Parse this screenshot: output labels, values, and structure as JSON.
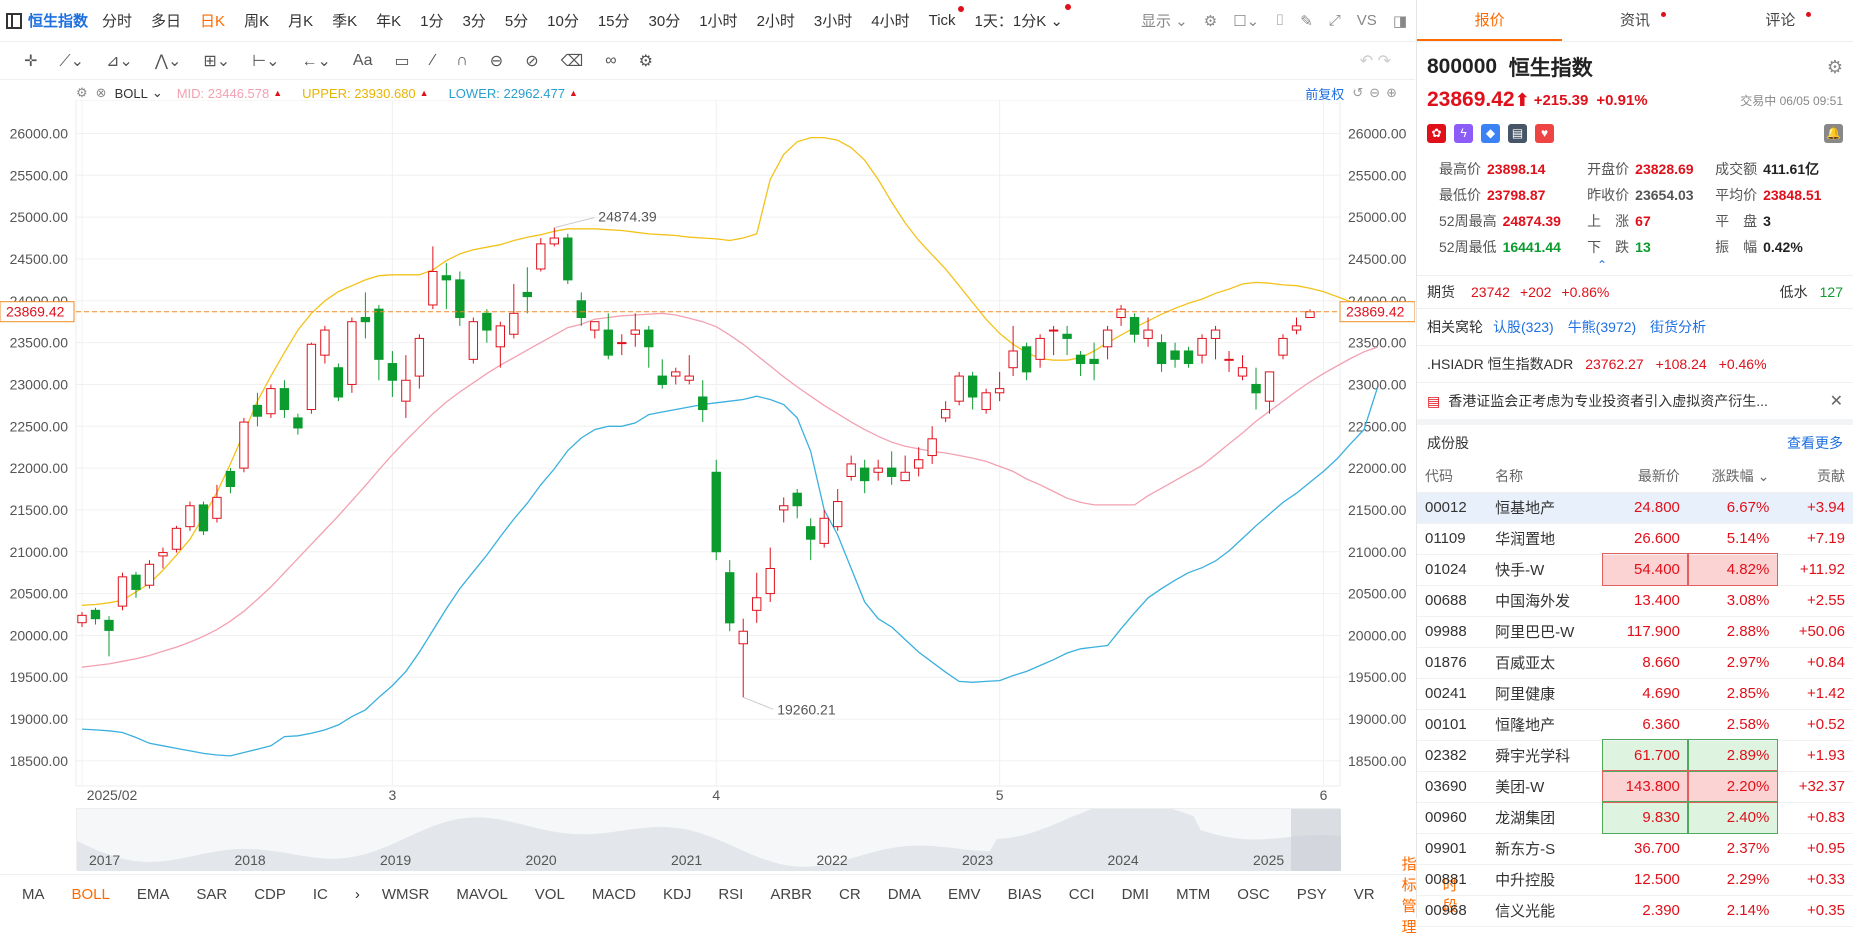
{
  "topbar": {
    "name": "恒生指数",
    "periods": [
      "分时",
      "多日",
      "日K",
      "周K",
      "月K",
      "季K",
      "年K",
      "1分",
      "3分",
      "5分",
      "10分",
      "15分",
      "30分",
      "1小时",
      "2小时",
      "3小时",
      "4小时",
      "Tick"
    ],
    "active": "日K",
    "dots": [
      "Tick"
    ],
    "range": "1天：1分K",
    "display": "显示"
  },
  "indicator": {
    "name": "BOLL",
    "mid_label": "MID:",
    "mid": "23446.578",
    "upper_label": "UPPER:",
    "upper": "23930.680",
    "lower_label": "LOWER:",
    "lower": "22962.477",
    "adjust": "前复权"
  },
  "colors": {
    "up": "#e0101b",
    "down": "#0b9b2e",
    "mid": "#f3a0b1",
    "upper": "#f3c21a",
    "lower": "#3ab0de",
    "accent": "#ff6a00",
    "link": "#1e6fe0"
  },
  "chart_data": {
    "type": "candlestick",
    "ylim": [
      18200,
      26400
    ],
    "yticks": [
      18500,
      19000,
      19500,
      20000,
      20500,
      21000,
      21500,
      22000,
      22500,
      23000,
      23500,
      24000,
      24500,
      25000,
      25500,
      26000
    ],
    "xlabels": [
      "2025/02",
      "3",
      "4",
      "5",
      "6"
    ],
    "current_price": "23869.42",
    "high_annotation": "24874.39",
    "low_annotation": "19260.21",
    "candles": [
      [
        20152,
        20240,
        20100,
        20280
      ],
      [
        20300,
        20200,
        20130,
        20330
      ],
      [
        20180,
        20060,
        19750,
        20230
      ],
      [
        20350,
        20700,
        20300,
        20750
      ],
      [
        20720,
        20550,
        20450,
        20760
      ],
      [
        20600,
        20850,
        20560,
        20900
      ],
      [
        20950,
        20990,
        20800,
        21050
      ],
      [
        21030,
        21280,
        20990,
        21310
      ],
      [
        21300,
        21550,
        21250,
        21600
      ],
      [
        21560,
        21250,
        21200,
        21600
      ],
      [
        21400,
        21650,
        21350,
        21800
      ],
      [
        21960,
        21780,
        21700,
        22000
      ],
      [
        22000,
        22550,
        21950,
        22600
      ],
      [
        22750,
        22620,
        22500,
        22900
      ],
      [
        22650,
        22950,
        22600,
        23000
      ],
      [
        22950,
        22700,
        22600,
        23050
      ],
      [
        22600,
        22480,
        22400,
        22650
      ],
      [
        22700,
        23480,
        22650,
        23500
      ],
      [
        23350,
        23650,
        23250,
        23700
      ],
      [
        23200,
        22850,
        22800,
        23250
      ],
      [
        23000,
        23750,
        22900,
        23800
      ],
      [
        23800,
        23750,
        23550,
        24100
      ],
      [
        23900,
        23300,
        23050,
        23950
      ],
      [
        23250,
        23050,
        22850,
        23400
      ],
      [
        22800,
        23050,
        22600,
        23350
      ],
      [
        23100,
        23550,
        22950,
        23600
      ],
      [
        23950,
        24350,
        23900,
        24650
      ],
      [
        24300,
        24250,
        23900,
        24450
      ],
      [
        24250,
        23800,
        23700,
        24350
      ],
      [
        23300,
        23750,
        23250,
        23800
      ],
      [
        23850,
        23650,
        23500,
        23900
      ],
      [
        23450,
        23700,
        23200,
        23750
      ],
      [
        23600,
        23850,
        23550,
        24200
      ],
      [
        24100,
        24050,
        23850,
        24400
      ],
      [
        24380,
        24680,
        24350,
        24750
      ],
      [
        24680,
        24750,
        24650,
        24874
      ],
      [
        24750,
        24250,
        24200,
        24800
      ],
      [
        24000,
        23800,
        23700,
        24100
      ],
      [
        23650,
        23750,
        23550,
        23750
      ],
      [
        23650,
        23350,
        23300,
        23850
      ],
      [
        23500,
        23500,
        23350,
        23600
      ],
      [
        23600,
        23650,
        23450,
        23850
      ],
      [
        23650,
        23450,
        23200,
        23700
      ],
      [
        23100,
        23000,
        22950,
        23300
      ],
      [
        23100,
        23150,
        23000,
        23200
      ],
      [
        23050,
        23100,
        23000,
        23350
      ],
      [
        22850,
        22700,
        22550,
        23050
      ],
      [
        21950,
        21000,
        20900,
        22100
      ],
      [
        20750,
        20150,
        20050,
        20900
      ],
      [
        19900,
        20050,
        19260,
        20200
      ],
      [
        20300,
        20450,
        20150,
        20750
      ],
      [
        20500,
        20800,
        20400,
        21050
      ],
      [
        21500,
        21550,
        21350,
        21650
      ],
      [
        21700,
        21550,
        21400,
        21750
      ],
      [
        21300,
        21150,
        20900,
        21400
      ],
      [
        21100,
        21400,
        21050,
        21500
      ],
      [
        21300,
        21600,
        21250,
        21750
      ],
      [
        21900,
        22050,
        21850,
        22150
      ],
      [
        22000,
        21850,
        21700,
        22100
      ],
      [
        21950,
        22000,
        21850,
        22100
      ],
      [
        22000,
        21900,
        21800,
        22200
      ],
      [
        21850,
        21950,
        21850,
        22150
      ],
      [
        22000,
        22100,
        21900,
        22250
      ],
      [
        22150,
        22350,
        22050,
        22500
      ],
      [
        22600,
        22700,
        22550,
        22800
      ],
      [
        22800,
        23100,
        22750,
        23150
      ],
      [
        23100,
        22850,
        22700,
        23150
      ],
      [
        22700,
        22900,
        22650,
        22950
      ],
      [
        22900,
        22950,
        22800,
        23150
      ],
      [
        23200,
        23400,
        23100,
        23700
      ],
      [
        23450,
        23150,
        23050,
        23500
      ],
      [
        23300,
        23550,
        23200,
        23600
      ],
      [
        23650,
        23650,
        23350,
        23700
      ],
      [
        23600,
        23550,
        23350,
        23700
      ],
      [
        23350,
        23250,
        23100,
        23400
      ],
      [
        23300,
        23250,
        23050,
        23500
      ],
      [
        23450,
        23650,
        23300,
        23700
      ],
      [
        23800,
        23900,
        23700,
        23950
      ],
      [
        23800,
        23600,
        23500,
        23850
      ],
      [
        23550,
        23650,
        23450,
        23800
      ],
      [
        23500,
        23250,
        23150,
        23600
      ],
      [
        23400,
        23300,
        23200,
        23500
      ],
      [
        23400,
        23250,
        23200,
        23450
      ],
      [
        23350,
        23550,
        23250,
        23600
      ],
      [
        23550,
        23650,
        23300,
        23700
      ],
      [
        23300,
        23300,
        23150,
        23400
      ],
      [
        23100,
        23200,
        23050,
        23350
      ],
      [
        23000,
        22900,
        22700,
        23200
      ],
      [
        22800,
        23150,
        22650,
        23150
      ],
      [
        23350,
        23550,
        23300,
        23600
      ],
      [
        23650,
        23700,
        23600,
        23800
      ],
      [
        23800,
        23869,
        23798,
        23898
      ]
    ],
    "mid": [
      19620,
      19640,
      19660,
      19690,
      19720,
      19760,
      19810,
      19860,
      19920,
      19990,
      20070,
      20170,
      20290,
      20430,
      20580,
      20750,
      20920,
      21090,
      21260,
      21430,
      21610,
      21790,
      21980,
      22160,
      22330,
      22490,
      22650,
      22790,
      22910,
      23020,
      23130,
      23230,
      23320,
      23410,
      23500,
      23590,
      23680,
      23720,
      23780,
      23800,
      23820,
      23830,
      23840,
      23850,
      23830,
      23790,
      23750,
      23690,
      23590,
      23480,
      23350,
      23220,
      23090,
      22970,
      22860,
      22750,
      22650,
      22550,
      22460,
      22380,
      22310,
      22260,
      22230,
      22200,
      22180,
      22150,
      22120,
      22080,
      22020,
      21960,
      21870,
      21800,
      21720,
      21640,
      21590,
      21560,
      21560,
      21560,
      21560,
      21670,
      21760,
      21850,
      21940,
      22030,
      22160,
      22290,
      22420,
      22560,
      22680,
      22800,
      22920,
      23030,
      23130,
      23220,
      23310,
      23390,
      23446
    ],
    "upper": [
      20360,
      20370,
      20390,
      20420,
      20520,
      20620,
      20780,
      20960,
      21150,
      21420,
      21710,
      22050,
      22420,
      22800,
      23100,
      23380,
      23650,
      23850,
      24000,
      24110,
      24180,
      24250,
      24300,
      24310,
      24310,
      24310,
      24370,
      24480,
      24560,
      24610,
      24640,
      24670,
      24720,
      24760,
      24790,
      24830,
      24860,
      24860,
      24860,
      24850,
      24840,
      24820,
      24800,
      24790,
      24780,
      24760,
      24750,
      24740,
      24720,
      24750,
      24800,
      25450,
      25750,
      25900,
      25950,
      25950,
      25920,
      25830,
      25680,
      25450,
      25180,
      24930,
      24720,
      24550,
      24380,
      24180,
      23980,
      23780,
      23610,
      23480,
      23380,
      23310,
      23290,
      23290,
      23320,
      23400,
      23500,
      23590,
      23680,
      23760,
      23840,
      23910,
      23970,
      24020,
      24090,
      24140,
      24200,
      24220,
      24210,
      24190,
      24180,
      24150,
      24110,
      24050,
      23990,
      23940,
      23930
    ],
    "lower": [
      18880,
      18870,
      18860,
      18840,
      18780,
      18710,
      18680,
      18650,
      18620,
      18590,
      18570,
      18560,
      18600,
      18640,
      18680,
      18790,
      18800,
      18830,
      18870,
      18930,
      19030,
      19110,
      19260,
      19400,
      19570,
      19800,
      20060,
      20320,
      20560,
      20760,
      20960,
      21180,
      21390,
      21580,
      21800,
      21990,
      22210,
      22360,
      22460,
      22500,
      22500,
      22540,
      22640,
      22670,
      22700,
      22730,
      22760,
      22780,
      22800,
      22820,
      22860,
      22820,
      22760,
      22600,
      22200,
      21500,
      21200,
      20800,
      20400,
      20200,
      20100,
      19950,
      19800,
      19680,
      19560,
      19450,
      19440,
      19450,
      19460,
      19520,
      19570,
      19640,
      19710,
      19790,
      19840,
      19860,
      19880,
      20080,
      20270,
      20450,
      20560,
      20660,
      20750,
      20810,
      20890,
      21010,
      21160,
      21310,
      21450,
      21590,
      21700,
      21830,
      21960,
      22110,
      22290,
      22460,
      22962
    ]
  },
  "navigator": {
    "years": [
      "2017",
      "2018",
      "2019",
      "2020",
      "2021",
      "2022",
      "2023",
      "2024",
      "2025"
    ]
  },
  "bottom": {
    "tabs": [
      "MA",
      "BOLL",
      "EMA",
      "SAR",
      "CDP",
      "IC",
      "WMSR",
      "MAVOL",
      "VOL",
      "MACD",
      "KDJ",
      "RSI",
      "ARBR",
      "CR",
      "DMA",
      "EMV",
      "BIAS",
      "CCI",
      "DMI",
      "MTM",
      "OSC",
      "PSY",
      "VR"
    ],
    "active": "BOLL",
    "manage": "指标管理",
    "period": "时段"
  },
  "right": {
    "tabs": [
      "报价",
      "资讯",
      "评论"
    ],
    "code": "800000",
    "name": "恒生指数",
    "price": "23869.42",
    "arrow": "⬆",
    "chg": "+215.39",
    "pct": "+0.91%",
    "status": "交易中 06/05 09:51",
    "stats": [
      [
        [
          "最高价",
          "23898.14",
          "red"
        ],
        [
          "开盘价",
          "23828.69",
          "red"
        ],
        [
          "成交额",
          "411.61亿",
          "dark"
        ]
      ],
      [
        [
          "最低价",
          "23798.87",
          "red"
        ],
        [
          "昨收价",
          "23654.03",
          "gray"
        ],
        [
          "平均价",
          "23848.51",
          "red"
        ]
      ],
      [
        [
          "52周最高",
          "24874.39",
          "red"
        ],
        [
          "上　涨",
          "67",
          "red"
        ],
        [
          "平　盘",
          "3",
          "dark"
        ]
      ],
      [
        [
          "52周最低",
          "16441.44",
          "green"
        ],
        [
          "下　跌",
          "13",
          "green"
        ],
        [
          "振　幅",
          "0.42%",
          "dark"
        ]
      ]
    ],
    "futures": {
      "label": "期货",
      "price": "23742",
      "chg": "+202",
      "pct": "+0.86%",
      "discount": "低水",
      "value": "127"
    },
    "links": {
      "label": "相关窝轮",
      "a": "认股(323)",
      "b": "牛熊(3972)",
      "c": "街货分析"
    },
    "adr": {
      "label": ".HSIADR 恒生指数ADR",
      "price": "23762.27",
      "chg": "+108.24",
      "pct": "+0.46%"
    },
    "news": "香港证监会正考虑为专业投资者引入虚拟资产衍生...",
    "constituents": {
      "title": "成份股",
      "more": "查看更多",
      "headers": [
        "代码",
        "名称",
        "最新价",
        "涨跌幅",
        "贡献"
      ],
      "rows": [
        [
          "00012",
          "恒基地产",
          "24.800",
          "6.67%",
          "+3.94",
          ""
        ],
        [
          "01109",
          "华润置地",
          "26.600",
          "5.14%",
          "+7.19",
          ""
        ],
        [
          "01024",
          "快手-W",
          "54.400",
          "4.82%",
          "+11.92",
          "red"
        ],
        [
          "00688",
          "中国海外发",
          "13.400",
          "3.08%",
          "+2.55",
          ""
        ],
        [
          "09988",
          "阿里巴巴-W",
          "117.900",
          "2.88%",
          "+50.06",
          ""
        ],
        [
          "01876",
          "百威亚太",
          "8.660",
          "2.97%",
          "+0.84",
          ""
        ],
        [
          "00241",
          "阿里健康",
          "4.690",
          "2.85%",
          "+1.42",
          ""
        ],
        [
          "00101",
          "恒隆地产",
          "6.360",
          "2.58%",
          "+0.52",
          ""
        ],
        [
          "02382",
          "舜宇光学科",
          "61.700",
          "2.89%",
          "+1.93",
          "green"
        ],
        [
          "03690",
          "美团-W",
          "143.800",
          "2.20%",
          "+32.37",
          "red"
        ],
        [
          "00960",
          "龙湖集团",
          "9.830",
          "2.40%",
          "+0.83",
          "green"
        ],
        [
          "09901",
          "新东方-S",
          "36.700",
          "2.37%",
          "+0.95",
          ""
        ],
        [
          "00881",
          "中升控股",
          "12.500",
          "2.29%",
          "+0.33",
          ""
        ],
        [
          "00968",
          "信义光能",
          "2.390",
          "2.14%",
          "+0.35",
          ""
        ]
      ]
    }
  }
}
